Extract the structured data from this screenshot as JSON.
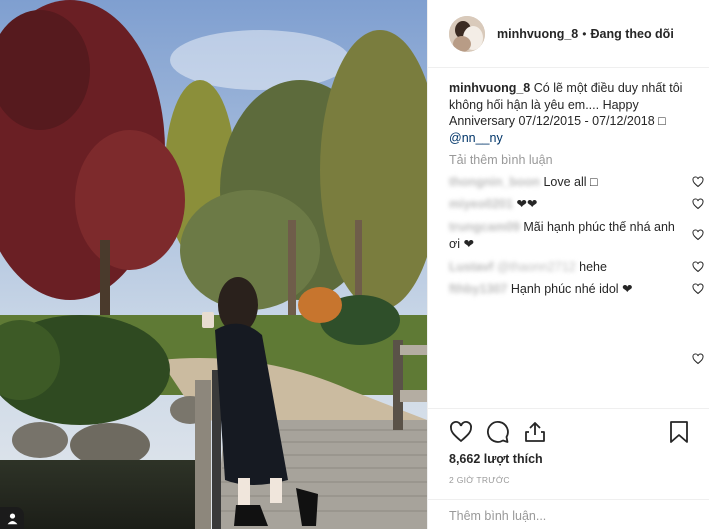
{
  "post": {
    "username": "minhvuong_8",
    "follow_status": "Đang theo dõi",
    "separator": "•",
    "caption_user": "minhvuong_8",
    "caption_text": "Có lẽ một điều duy nhất tôi không hối hận là yêu em.... Happy Anniversary 07/12/2015 - 07/12/2018 □",
    "caption_mention": "@nn__ny",
    "load_more": "Tải thêm bình luận",
    "likes": "8,662 lượt thích",
    "time": "2 GIỜ TRƯỚC",
    "add_comment_placeholder": "Thêm bình luận..."
  },
  "comments": [
    {
      "user": "thongnin_boon",
      "text": "Love all □"
    },
    {
      "user": "miyeo0201",
      "text": "❤❤"
    },
    {
      "user": "trungcam09",
      "text": "Mãi hạnh phúc thế nhá anh ơi ❤"
    },
    {
      "user": "Lustavf",
      "mention": "@thaonn2712",
      "text": "hehe"
    },
    {
      "user": "fthby1307",
      "text": "Hạnh phúc nhé idol ❤"
    }
  ],
  "icons": {
    "like": "heart-icon",
    "comment": "comment-icon",
    "share": "share-icon",
    "save": "bookmark-icon",
    "tag": "user-tag-icon"
  },
  "colors": {
    "text": "#262626",
    "muted": "#999999",
    "link": "#003569",
    "border": "#efefef"
  }
}
